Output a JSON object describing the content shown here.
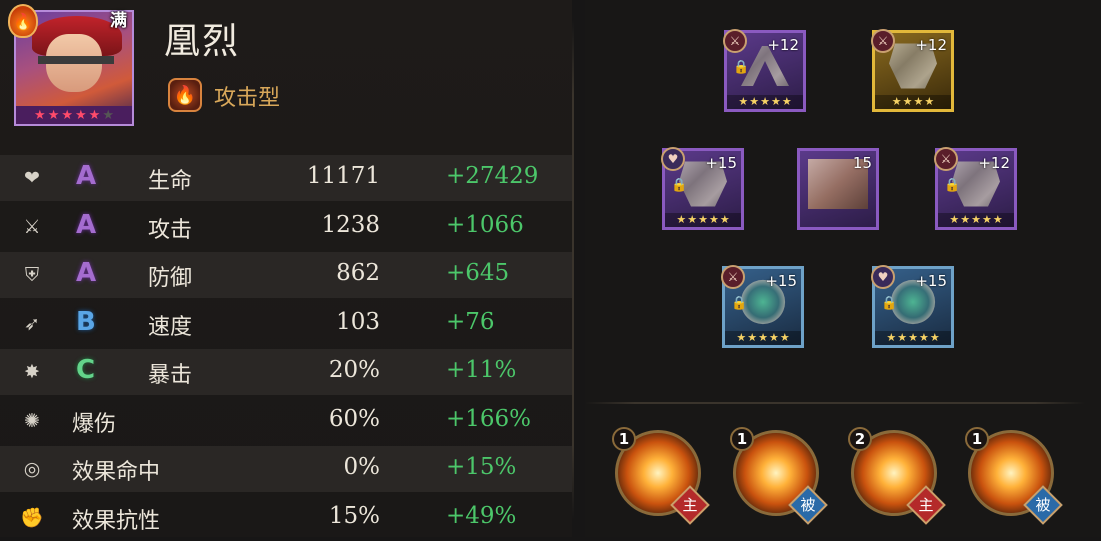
{
  "character": {
    "name": "凰烈",
    "full_badge": "满",
    "type_label": "攻击型",
    "portrait_stars": 5
  },
  "stats": [
    {
      "icon": "heart-crack-icon",
      "grade": "A",
      "label": "生命",
      "base": "11171",
      "bonus": "+27429"
    },
    {
      "icon": "sword-icon",
      "grade": "A",
      "label": "攻击",
      "base": "1238",
      "bonus": "+1066"
    },
    {
      "icon": "shield-lion-icon",
      "grade": "A",
      "label": "防御",
      "base": "862",
      "bonus": "+645"
    },
    {
      "icon": "speed-wing-icon",
      "grade": "B",
      "label": "速度",
      "base": "103",
      "bonus": "+76"
    },
    {
      "icon": "critical-burst-icon",
      "grade": "C",
      "label": "暴击",
      "base": "20%",
      "bonus": "+11%"
    },
    {
      "icon": "critical-damage-icon",
      "grade": "",
      "label": "爆伤",
      "base": "60%",
      "bonus": "+166%"
    },
    {
      "icon": "target-hit-icon",
      "grade": "",
      "label": "效果命中",
      "base": "0%",
      "bonus": "+15%"
    },
    {
      "icon": "fist-resist-icon",
      "grade": "",
      "label": "效果抗性",
      "base": "15%",
      "bonus": "+49%"
    }
  ],
  "equipment": [
    {
      "slot": "weapon",
      "level": "+12",
      "frame": "purple",
      "stars": 5
    },
    {
      "slot": "armor",
      "level": "+12",
      "frame": "gold",
      "stars": 4
    },
    {
      "slot": "helmet",
      "level": "+15",
      "frame": "purple",
      "stars": 5
    },
    {
      "slot": "center",
      "level": "15",
      "frame": "purple",
      "stars": 0
    },
    {
      "slot": "boots",
      "level": "+12",
      "frame": "purple",
      "stars": 5
    },
    {
      "slot": "ring",
      "level": "+15",
      "frame": "blue",
      "stars": 5
    },
    {
      "slot": "necklace",
      "level": "+15",
      "frame": "blue",
      "stars": 5
    }
  ],
  "skills": [
    {
      "level": "1",
      "tag": "主",
      "kind": "active"
    },
    {
      "level": "1",
      "tag": "被",
      "kind": "passive"
    },
    {
      "level": "2",
      "tag": "主",
      "kind": "active"
    },
    {
      "level": "1",
      "tag": "被",
      "kind": "passive"
    }
  ],
  "icons": {
    "star": "★",
    "lock": "🔒"
  }
}
